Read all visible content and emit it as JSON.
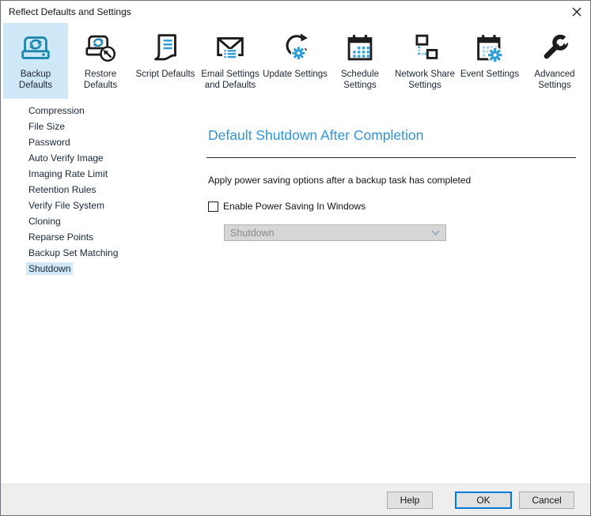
{
  "window": {
    "title": "Reflect Defaults and Settings"
  },
  "toolbar": {
    "items": [
      {
        "label": "Backup Defaults",
        "selected": true
      },
      {
        "label": "Restore Defaults",
        "selected": false
      },
      {
        "label": "Script Defaults",
        "selected": false
      },
      {
        "label": "Email Settings and Defaults",
        "selected": false
      },
      {
        "label": "Update Settings",
        "selected": false
      },
      {
        "label": "Schedule Settings",
        "selected": false
      },
      {
        "label": "Network Share Settings",
        "selected": false
      },
      {
        "label": "Event Settings",
        "selected": false
      },
      {
        "label": "Advanced Settings",
        "selected": false
      }
    ]
  },
  "sidebar": {
    "items": [
      {
        "label": "Compression",
        "selected": false
      },
      {
        "label": "File Size",
        "selected": false
      },
      {
        "label": "Password",
        "selected": false
      },
      {
        "label": "Auto Verify Image",
        "selected": false
      },
      {
        "label": "Imaging Rate Limit",
        "selected": false
      },
      {
        "label": "Retention Rules",
        "selected": false
      },
      {
        "label": "Verify File System",
        "selected": false
      },
      {
        "label": "Cloning",
        "selected": false
      },
      {
        "label": "Reparse Points",
        "selected": false
      },
      {
        "label": "Backup Set Matching",
        "selected": false
      },
      {
        "label": "Shutdown",
        "selected": true
      }
    ]
  },
  "content": {
    "heading": "Default Shutdown After Completion",
    "description": "Apply power saving options after a backup task has completed",
    "checkbox_label": "Enable Power Saving In Windows",
    "checkbox_checked": false,
    "dropdown_value": "Shutdown",
    "dropdown_disabled": true
  },
  "footer": {
    "help_label": "Help",
    "ok_label": "OK",
    "cancel_label": "Cancel"
  },
  "icons": {
    "close": "x-glyph",
    "chevron": "chevron-down",
    "accent_blue": "#2f9cd8",
    "icon_teal": "#1e88ae",
    "icon_black": "#1c1c1c",
    "selection_bg": "#cfe8f7",
    "heading_blue": "#2e96d6",
    "ok_border": "#0078d7"
  }
}
